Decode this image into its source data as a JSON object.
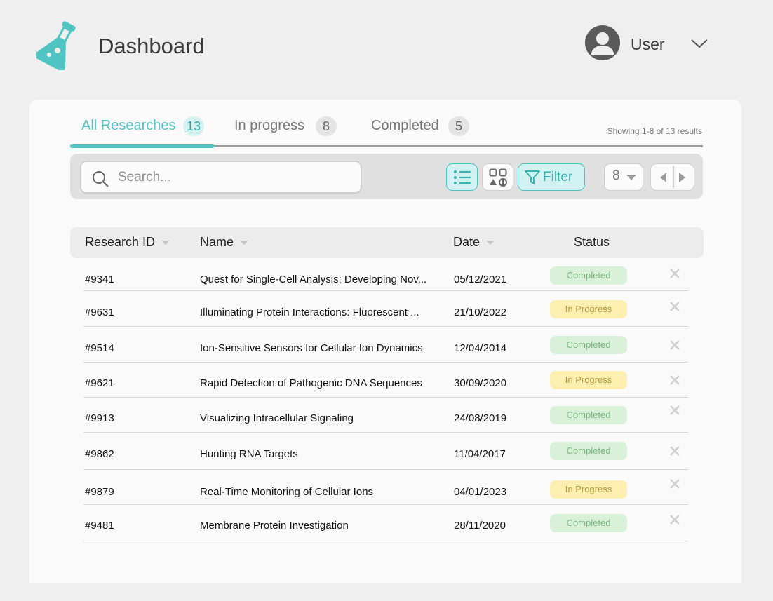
{
  "header": {
    "title": "Dashboard",
    "user_name": "User",
    "logo_icon": "flask-icon",
    "accent_color": "#4fc4c2"
  },
  "tabs": [
    {
      "label": "All Researches",
      "count": "13",
      "active": true
    },
    {
      "label": "In progress",
      "count": "8",
      "active": false
    },
    {
      "label": "Completed",
      "count": "5",
      "active": false
    }
  ],
  "results_info": "Showing 1-8 of 13 results",
  "toolbar": {
    "search_placeholder": "Search...",
    "list_view_icon": "list-view-icon",
    "grid_view_icon": "grid-view-icon",
    "filter_label": "Filter",
    "per_page": "8"
  },
  "table": {
    "columns": [
      "Research ID",
      "Name",
      "Date",
      "Status"
    ],
    "rows": [
      {
        "id": "#9341",
        "name": "Quest for Single-Cell Analysis: Developing Nov...",
        "date": "05/12/2021",
        "status": "Completed"
      },
      {
        "id": "#9631",
        "name": "Illuminating Protein Interactions: Fluorescent ...",
        "date": "21/10/2022",
        "status": "In Progress"
      },
      {
        "id": "#9514",
        "name": "Ion-Sensitive Sensors for Cellular Ion Dynamics",
        "date": "12/04/2014",
        "status": "Completed"
      },
      {
        "id": "#9621",
        "name": "Rapid Detection of Pathogenic DNA Sequences",
        "date": "30/09/2020",
        "status": "In Progress"
      },
      {
        "id": "#9913",
        "name": "Visualizing Intracellular Signaling",
        "date": "24/08/2019",
        "status": "Completed"
      },
      {
        "id": "#9862",
        "name": "Hunting RNA Targets",
        "date": "11/04/2017",
        "status": "Completed"
      },
      {
        "id": "#9879",
        "name": "Real-Time Monitoring of Cellular Ions",
        "date": "04/01/2023",
        "status": "In Progress"
      },
      {
        "id": "#9481",
        "name": "Membrane Protein Investigation",
        "date": "28/11/2020",
        "status": "Completed"
      }
    ]
  }
}
